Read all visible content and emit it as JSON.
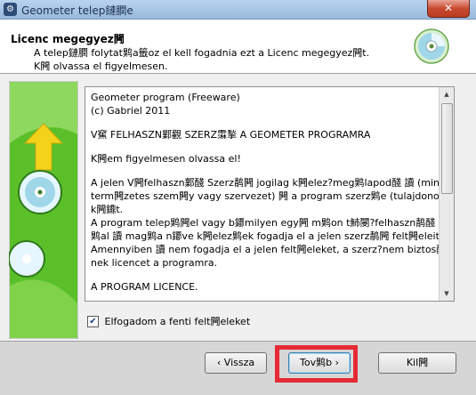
{
  "window": {
    "title": "Geometer telep鏈膶e",
    "close_label": "✕",
    "app_icon": "setup-icon"
  },
  "header": {
    "title": "Licenc megegyez闁",
    "desc_line1": "A telep鏈膶 folytat䴗a籤oz el kell fogadnia ezt a Licenc megegyez闁t.",
    "desc_line2": "K闁 olvassa el figyelmesen."
  },
  "license": {
    "lines": [
      "Geometer program (Freeware)",
      "(c) Gabriel 2011",
      "",
      "V䆶 FELHASZN鄴觀 SZERZ䨬揫 A GEOMETER PROGRAMRA",
      "",
      "K闁em figyelmesen olvassa el!",
      "",
      "A jelen V闁felhaszn鄴醆 Szerz䴖闁 jogilag k闁elez?meg䴗lapod醆 讀 (mint",
      "term闁zetes szem闁y vagy szervezet) 闁 a program szerz䴗e (tulajdonosa)",
      "k闁鐤t.",
      "A program telep䴗闁el vagy b䥮milyen egy闁 m䴗on t䰽閿?felhaszn䴖醆",
      "䴗al 讀 mag䴗a n䥮ve k闁elez䴗ek fogadja el a jelen szerz䴖闁 felt闁eleit.",
      "Amennyiben 讀 nem fogadja el a jelen felt闁eleket, a szerz?nem biztos醆 讀",
      "nek licencet a programra.",
      "",
      "A PROGRAM LICENCE."
    ]
  },
  "accept": {
    "label": "Elfogadom a fenti felt闁eleket",
    "checked": true,
    "check_mark": "✔"
  },
  "buttons": {
    "back": "‹ Vissza",
    "next": "Tov䴗b ›",
    "exit": "Kil闁"
  },
  "colors": {
    "highlight": "#e52a34",
    "green": "#5bbf2a",
    "arrow": "#f3d21a"
  }
}
